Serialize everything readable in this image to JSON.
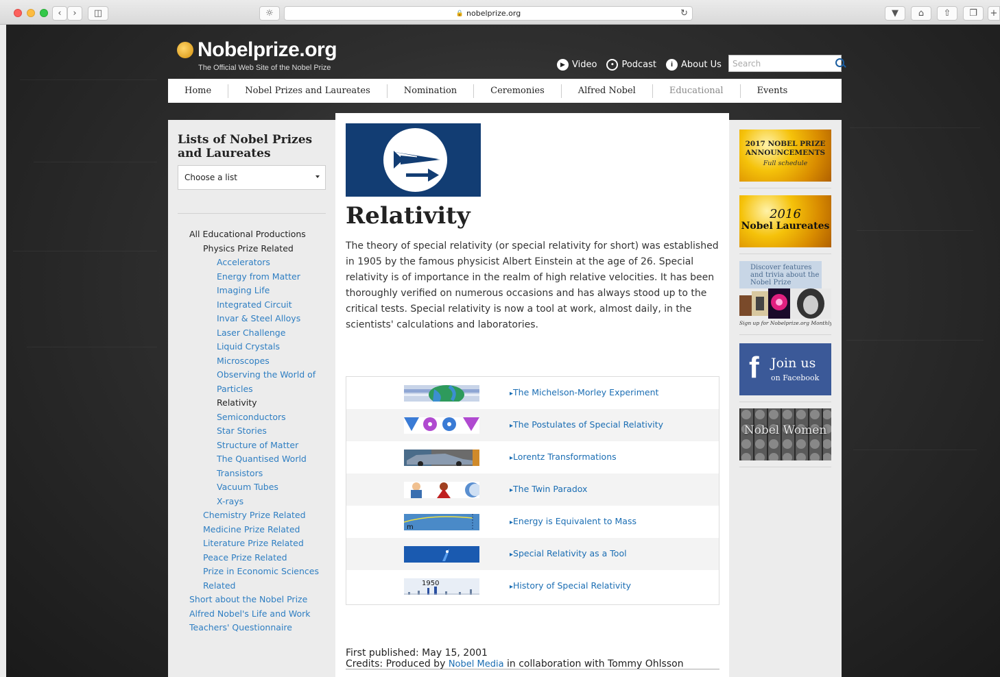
{
  "browser": {
    "url": "nobelprize.org"
  },
  "header": {
    "logo_title": "Nobelprize.org",
    "logo_tagline": "The Official Web Site of the Nobel Prize",
    "links": [
      {
        "label": "Video",
        "icon": "play-icon"
      },
      {
        "label": "Podcast",
        "icon": "podcast-icon"
      },
      {
        "label": "About Us",
        "icon": "info-icon"
      }
    ],
    "search_placeholder": "Search"
  },
  "nav": {
    "items": [
      "Home",
      "Nobel Prizes and Laureates",
      "Nomination",
      "Ceremonies",
      "Alfred Nobel",
      "Educational",
      "Events"
    ]
  },
  "sidebar": {
    "title": "Lists of Nobel Prizes and Laureates",
    "select_value": "Choose a list",
    "tree": [
      {
        "label": "All Educational Productions",
        "level": 0,
        "link": false
      },
      {
        "label": "Physics Prize Related",
        "level": 1,
        "link": false
      },
      {
        "label": "Accelerators",
        "level": 2,
        "link": true
      },
      {
        "label": "Energy from Matter",
        "level": 2,
        "link": true
      },
      {
        "label": "Imaging Life",
        "level": 2,
        "link": true
      },
      {
        "label": "Integrated Circuit",
        "level": 2,
        "link": true
      },
      {
        "label": "Invar & Steel Alloys",
        "level": 2,
        "link": true
      },
      {
        "label": "Laser Challenge",
        "level": 2,
        "link": true
      },
      {
        "label": "Liquid Crystals",
        "level": 2,
        "link": true
      },
      {
        "label": "Microscopes",
        "level": 2,
        "link": true
      },
      {
        "label": "Observing the World of",
        "level": 2,
        "link": true
      },
      {
        "label": "Particles",
        "level": 2,
        "link": true
      },
      {
        "label": "Relativity",
        "level": 2,
        "link": false
      },
      {
        "label": "Semiconductors",
        "level": 2,
        "link": true
      },
      {
        "label": "Star Stories",
        "level": 2,
        "link": true
      },
      {
        "label": "Structure of Matter",
        "level": 2,
        "link": true
      },
      {
        "label": "The Quantised World",
        "level": 2,
        "link": true
      },
      {
        "label": "Transistors",
        "level": 2,
        "link": true
      },
      {
        "label": "Vacuum Tubes",
        "level": 2,
        "link": true
      },
      {
        "label": "X-rays",
        "level": 2,
        "link": true
      },
      {
        "label": "Chemistry Prize Related",
        "level": 1,
        "link": true
      },
      {
        "label": "Medicine Prize Related",
        "level": 1,
        "link": true
      },
      {
        "label": "Literature Prize Related",
        "level": 1,
        "link": true
      },
      {
        "label": "Peace Prize Related",
        "level": 1,
        "link": true
      },
      {
        "label": "Prize in Economic Sciences",
        "level": 1,
        "link": true
      },
      {
        "label": "Related",
        "level": 1,
        "link": true
      },
      {
        "label": "Short about the Nobel Prize",
        "level": 0,
        "link": true
      },
      {
        "label": "Alfred Nobel's Life and Work",
        "level": 0,
        "link": true
      },
      {
        "label": "Teachers' Questionnaire",
        "level": 0,
        "link": true
      }
    ]
  },
  "main": {
    "title": "Relativity",
    "lead": "The theory of special relativity (or special relativity for short) was established in 1905 by the famous physicist Albert Einstein at the age of 26. Special relativity is of importance in the realm of high relative velocities. It has been thoroughly verified on numerous occasions and has always stood up to the critical tests. Special relativity is now a tool at work, almost daily, in the scientists' calculations and laboratories.",
    "topics": [
      {
        "label": "The Michelson-Morley Experiment",
        "thumb": "earth"
      },
      {
        "label": "The Postulates of Special Relativity",
        "thumb": "balloons"
      },
      {
        "label": "Lorentz Transformations",
        "thumb": "car"
      },
      {
        "label": "The Twin Paradox",
        "thumb": "twins"
      },
      {
        "label": "Energy is Equivalent to Mass",
        "thumb": "mass",
        "thumb_text": "m"
      },
      {
        "label": "Special Relativity as a Tool",
        "thumb": "tool"
      },
      {
        "label": "History of Special Relativity",
        "thumb": "history",
        "thumb_text": "1950"
      }
    ],
    "first_published": "First published: May 15, 2001",
    "credits_prefix": "Credits: Produced by ",
    "credits_link": "Nobel Media",
    "credits_suffix": " in collaboration with Tommy Ohlsson"
  },
  "promos": {
    "p1_line1": "2017 NOBEL PRIZE",
    "p1_line2": "ANNOUNCEMENTS",
    "p1_line3": "Full schedule",
    "p2_year": "2016",
    "p2_text": "Nobel Laureates",
    "p3_text": "Discover features and trivia about the Nobel Prize",
    "p3_sub": "Sign up for Nobelprize.org Monthly",
    "fb_main": "Join us",
    "fb_sub": "on Facebook",
    "women": "Nobel Women"
  }
}
